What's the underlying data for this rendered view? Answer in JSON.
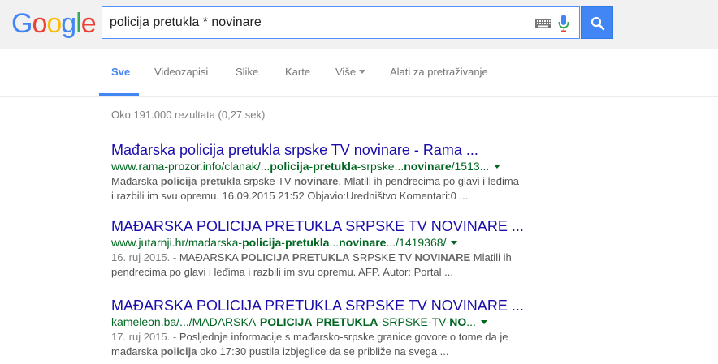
{
  "logo": [
    "G",
    "o",
    "o",
    "g",
    "l",
    "e"
  ],
  "logo_colors": [
    "#4285f4",
    "#ea4335",
    "#fbbc05",
    "#4285f4",
    "#34a853",
    "#ea4335"
  ],
  "search": {
    "query": "policija pretukla * novinare"
  },
  "tabs": [
    {
      "label": "Sve"
    },
    {
      "label": "Videozapisi"
    },
    {
      "label": "Slike"
    },
    {
      "label": "Karte"
    },
    {
      "label": "Više"
    },
    {
      "label": "Alati za pretraživanje"
    }
  ],
  "stats": "Oko 191.000 rezultata (0,27 sek)",
  "results": [
    {
      "title": "Mađarska policija pretukla srpske TV novinare - Rama ...",
      "url": [
        {
          "t": "www.rama-prozor.info/clanak/...",
          "b": false
        },
        {
          "t": "policija",
          "b": true
        },
        {
          "t": "-",
          "b": false
        },
        {
          "t": "pretukla",
          "b": true
        },
        {
          "t": "-srpske...",
          "b": false
        },
        {
          "t": "novinare",
          "b": true
        },
        {
          "t": "/1513...",
          "b": false
        }
      ],
      "snippet_lines": [
        [
          {
            "t": "Mađarska ",
            "b": false
          },
          {
            "t": "policija pretukla",
            "b": true
          },
          {
            "t": " srpske TV ",
            "b": false
          },
          {
            "t": "novinare",
            "b": true
          },
          {
            "t": ". Mlatili ih pendrecima po glavi i leđima",
            "b": false
          }
        ],
        [
          {
            "t": "i razbili im svu opremu. 16.09.2015 21:52 Objavio:Uredništvo Komentari:0 ...",
            "b": false
          }
        ]
      ]
    },
    {
      "title": "MAĐARSKA POLICIJA PRETUKLA SRPSKE TV NOVINARE ...",
      "url": [
        {
          "t": "www.jutarnji.hr/madarska-",
          "b": false
        },
        {
          "t": "policija",
          "b": true
        },
        {
          "t": "-",
          "b": false
        },
        {
          "t": "pretukla",
          "b": true
        },
        {
          "t": "...",
          "b": false
        },
        {
          "t": "novinare",
          "b": true
        },
        {
          "t": ".../1419368/",
          "b": false
        }
      ],
      "snippet_lines": [
        [
          {
            "t": "16. ruj 2015. - ",
            "b": false,
            "d": true
          },
          {
            "t": "MAĐARSKA ",
            "b": false
          },
          {
            "t": "POLICIJA PRETUKLA",
            "b": true
          },
          {
            "t": " SRPSKE TV ",
            "b": false
          },
          {
            "t": "NOVINARE",
            "b": true
          },
          {
            "t": " Mlatili ih",
            "b": false
          }
        ],
        [
          {
            "t": "pendrecima po glavi i leđima i razbili im svu opremu. AFP. Autor: Portal ...",
            "b": false
          }
        ]
      ]
    },
    {
      "title": "MAĐARSKA POLICIJA PRETUKLA SRPSKE TV NOVINARE ...",
      "url": [
        {
          "t": "kameleon.ba/.../MADARSKA-",
          "b": false
        },
        {
          "t": "POLICIJA",
          "b": true
        },
        {
          "t": "-",
          "b": false
        },
        {
          "t": "PRETUKLA",
          "b": true
        },
        {
          "t": "-SRPSKE-TV-",
          "b": false
        },
        {
          "t": "NO",
          "b": true
        },
        {
          "t": "...",
          "b": false
        }
      ],
      "snippet_lines": [
        [
          {
            "t": "17. ruj 2015. - ",
            "b": false,
            "d": true
          },
          {
            "t": "Posljednje informacije s mađarsko-srpske granice govore o tome da je",
            "b": false
          }
        ],
        [
          {
            "t": "mađarska ",
            "b": false
          },
          {
            "t": "policija",
            "b": true
          },
          {
            "t": " oko 17:30 pustila izbjeglice da se približe na svega ...",
            "b": false
          }
        ]
      ]
    }
  ],
  "colors": {
    "accent": "#4285f4",
    "link": "#1a0dab",
    "url": "#006621",
    "snippet": "#545454"
  }
}
